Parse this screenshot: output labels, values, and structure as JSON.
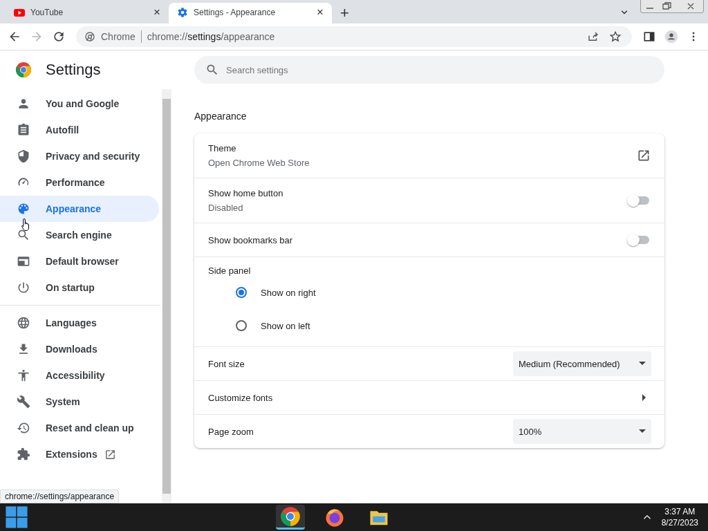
{
  "tabs": [
    {
      "title": "YouTube",
      "kind": "video",
      "selected": false,
      "close": "×"
    },
    {
      "title": "Settings - Appearance",
      "kind": "settings",
      "selected": true,
      "close": "×"
    }
  ],
  "new_tab": "+",
  "toolbar": {
    "site_label": "Chrome",
    "url_scheme": "chrome://",
    "url_host": "settings",
    "url_path": "/appearance"
  },
  "sidebar": {
    "title": "Settings",
    "groups": [
      [
        {
          "label": "You and Google",
          "kind": "page",
          "selected": false
        },
        {
          "label": "Autofill",
          "kind": "page",
          "selected": false
        },
        {
          "label": "Privacy and security",
          "kind": "page",
          "selected": false
        },
        {
          "label": "Performance",
          "kind": "page",
          "selected": false
        },
        {
          "label": "Appearance",
          "kind": "page",
          "selected": true
        },
        {
          "label": "Search engine",
          "kind": "page",
          "selected": false
        },
        {
          "label": "Default browser",
          "kind": "page",
          "selected": false
        },
        {
          "label": "On startup",
          "kind": "page",
          "selected": false
        }
      ],
      [
        {
          "label": "Languages",
          "kind": "page",
          "selected": false
        },
        {
          "label": "Downloads",
          "kind": "page",
          "selected": false
        },
        {
          "label": "Accessibility",
          "kind": "page",
          "selected": false
        },
        {
          "label": "System",
          "kind": "page",
          "selected": false
        },
        {
          "label": "Reset and clean up",
          "kind": "page",
          "selected": false
        },
        {
          "label": "Extensions",
          "kind": "external",
          "selected": false
        }
      ]
    ]
  },
  "search": {
    "placeholder": "Search settings"
  },
  "section_title": "Appearance",
  "rows": [
    {
      "kind": "link",
      "label": "Theme",
      "sublabel": "Open Chrome Web Store"
    },
    {
      "kind": "toggle",
      "label": "Show home button",
      "sublabel": "Disabled",
      "on": false
    },
    {
      "kind": "toggle",
      "label": "Show bookmarks bar",
      "on": false
    },
    {
      "kind": "radio_group",
      "label": "Side panel",
      "options": [
        {
          "label": "Show on right",
          "selected": true
        },
        {
          "label": "Show on left",
          "selected": false
        }
      ]
    },
    {
      "kind": "select",
      "label": "Font size",
      "value": "Medium (Recommended)"
    },
    {
      "kind": "submenu",
      "label": "Customize fonts"
    },
    {
      "kind": "select",
      "label": "Page zoom",
      "value": "100%"
    }
  ],
  "status_url": "chrome://settings/appearance",
  "taskbar": {
    "apps": [
      {
        "kind": "chrome",
        "selected": true
      },
      {
        "kind": "firefox",
        "selected": false
      },
      {
        "kind": "files",
        "selected": false
      }
    ],
    "time": "3:37 AM",
    "date": "8/27/2023"
  }
}
